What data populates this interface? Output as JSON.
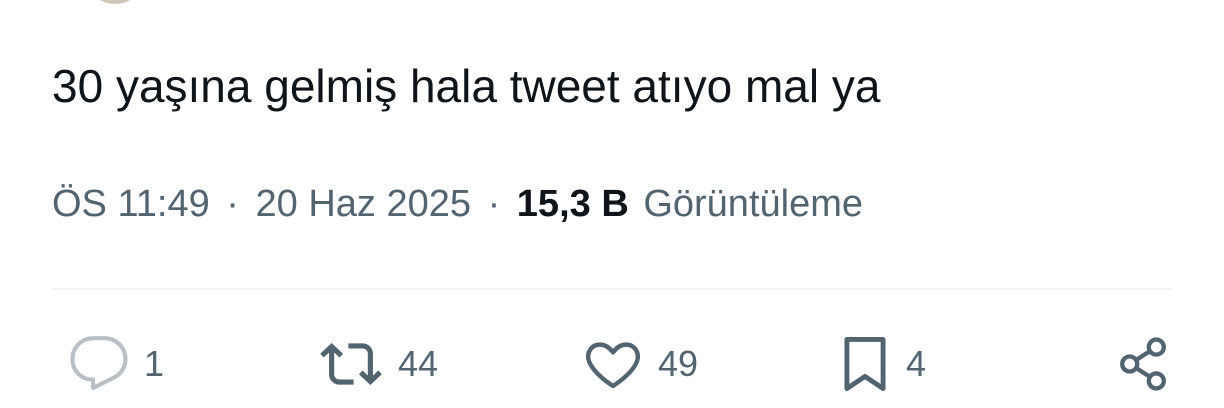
{
  "tweet": {
    "text": "30 yaşına gelmiş hala tweet atıyo mal ya",
    "time": "ÖS 11:49",
    "separator_1": "·",
    "date": "20 Haz 2025",
    "separator_2": "·",
    "views_count": "15,3 B",
    "views_label": "Görüntüleme"
  },
  "actions": {
    "reply": {
      "icon": "reply-icon",
      "count": "1"
    },
    "retweet": {
      "icon": "retweet-icon",
      "count": "44"
    },
    "like": {
      "icon": "heart-icon",
      "count": "49"
    },
    "bookmark": {
      "icon": "bookmark-icon",
      "count": "4"
    },
    "share": {
      "icon": "share-icon"
    }
  },
  "colors": {
    "text_primary": "#0f1419",
    "text_secondary": "#536471",
    "divider": "#eff3f4",
    "reply_icon": "#b8c0c6"
  }
}
